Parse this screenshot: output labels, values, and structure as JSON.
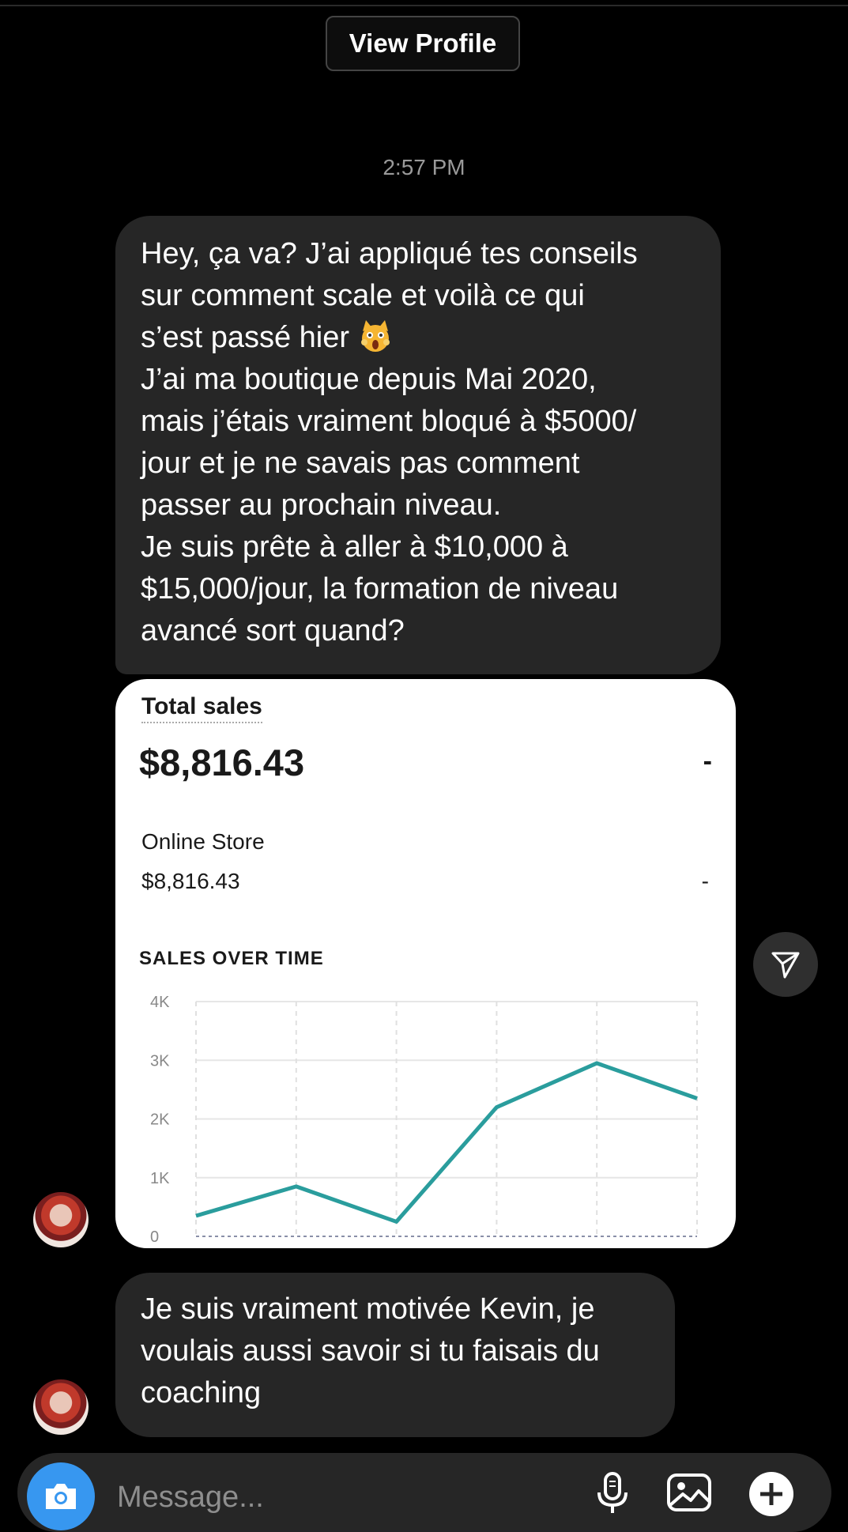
{
  "header": {
    "view_profile_label": "View Profile"
  },
  "thread": {
    "timestamp": "2:57 PM",
    "message_1": "Hey, ça va? J’ai appliqué tes conseils\nsur comment scale et voilà ce qui\ns’est passé hier ",
    "message_1_rest": "J’ai ma boutique depuis Mai 2020,\nmais j’étais vraiment bloqué à $5000/\njour et je ne savais pas comment\npasser au prochain niveau.\nJe suis prête à aller à $10,000 à\n$15,000/jour, la formation de niveau\navancé sort quand?",
    "message_1_emoji": "scream-cat-emoji",
    "message_2": "Je suis vraiment motivée Kevin, je\nvoulais aussi savoir si tu faisais du\ncoaching"
  },
  "sales_card": {
    "title": "Total sales",
    "amount": "$8,816.43",
    "dash": "-",
    "store_label": "Online Store",
    "store_amount": "$8,816.43",
    "store_dash": "-",
    "chart_heading": "SALES OVER TIME"
  },
  "chart_data": {
    "type": "line",
    "title": "SALES OVER TIME",
    "y_ticks": [
      "4K",
      "3K",
      "2K",
      "1K",
      "0"
    ],
    "ylim": [
      0,
      4000
    ],
    "grid": true,
    "series": [
      {
        "values": [
          350,
          850,
          250,
          2200,
          2950,
          2350
        ],
        "color": "#2a9d9d"
      }
    ]
  },
  "composer": {
    "placeholder": "Message...",
    "icons": [
      "camera-icon",
      "microphone-icon",
      "gallery-icon",
      "plus-icon"
    ],
    "accent": "#3797f0"
  }
}
